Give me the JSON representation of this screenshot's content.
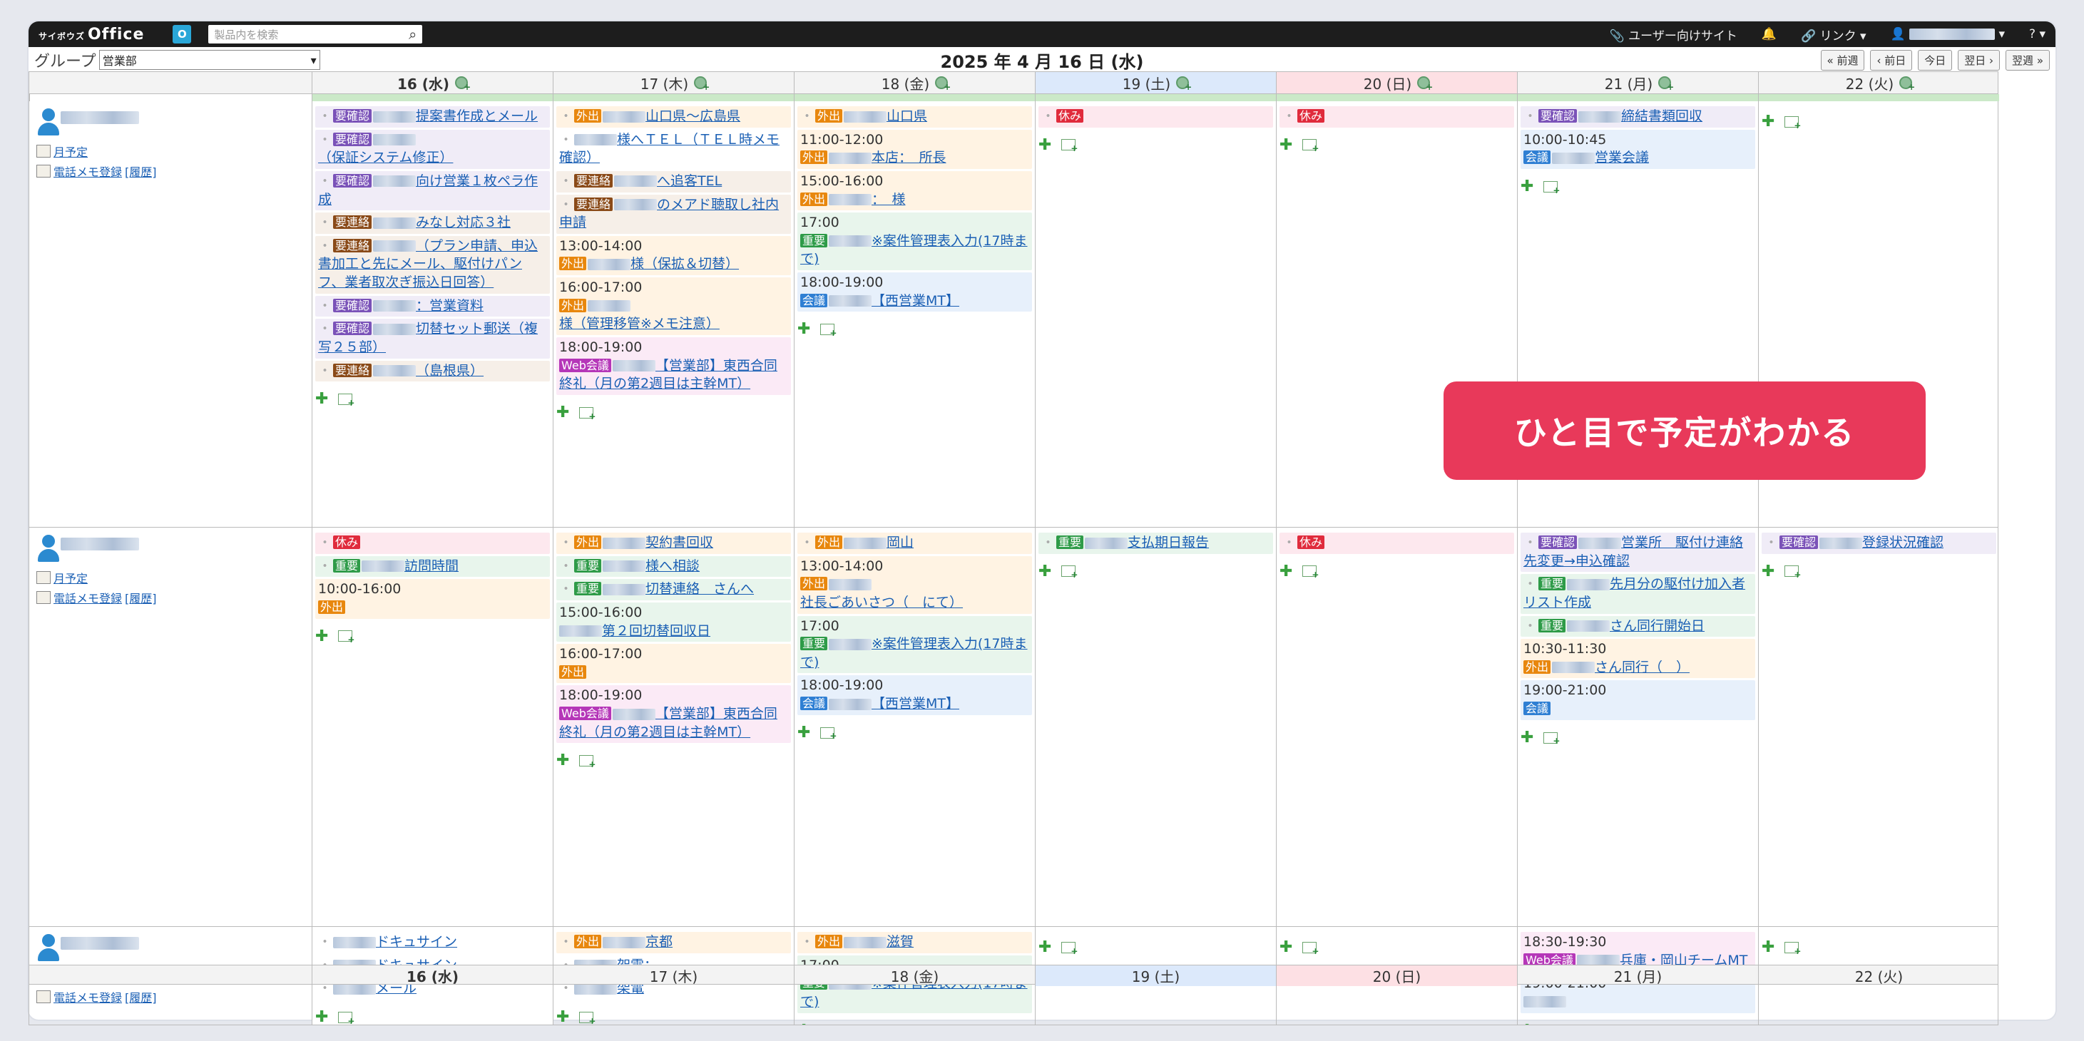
{
  "topbar": {
    "logo_small": "サイボウズ",
    "logo": "Office",
    "search_placeholder": "製品内を検索",
    "user_site": "ユーザー向けサイト",
    "links": "リンク",
    "help": "?"
  },
  "toolbar": {
    "group_label": "グループ",
    "group_value": "営業部",
    "date_title": "2025 年 4 月 16 日 (水)",
    "prev_week": "« 前週",
    "prev_day": "‹ 前日",
    "today": "今日",
    "next_day": "翌日 ›",
    "next_week": "翌週 »"
  },
  "days": [
    {
      "label": "16 (水)",
      "type": "today"
    },
    {
      "label": "17 (木)",
      "type": "weekday"
    },
    {
      "label": "18 (金)",
      "type": "weekday"
    },
    {
      "label": "19 (土)",
      "type": "sat"
    },
    {
      "label": "20 (日)",
      "type": "sun"
    },
    {
      "label": "21 (月)",
      "type": "weekday"
    },
    {
      "label": "22 (火)",
      "type": "weekday"
    }
  ],
  "user_links": {
    "monthly": "月予定",
    "phone_memo": "電話メモ登録",
    "history": "[履歴]"
  },
  "tags": {
    "kakunin": "要確認",
    "renraku": "要連絡",
    "gaishutsu": "外出",
    "juyo": "重要",
    "kaigi": "会議",
    "web": "Web会議",
    "yasumi": "休み"
  },
  "users": [
    {
      "days": [
        [
          {
            "c": "purple",
            "tag": "kakunin",
            "text": "提案書作成とメール"
          },
          {
            "c": "purple",
            "tag": "kakunin",
            "text": "（保証システム修正）"
          },
          {
            "c": "purple",
            "tag": "kakunin",
            "text": "向け営業１枚ペラ作成"
          },
          {
            "c": "beige",
            "tag": "renraku",
            "text": "みなし対応３社"
          },
          {
            "c": "beige",
            "tag": "renraku",
            "text": "（プラン申請、申込書加工と先にメール、駆付けパンフ、業者取次ぎ振込日回答）"
          },
          {
            "c": "purple",
            "tag": "kakunin",
            "text": "：営業資料"
          },
          {
            "c": "purple",
            "tag": "kakunin",
            "text": "切替セット郵送（複写２５部）"
          },
          {
            "c": "beige",
            "tag": "renraku",
            "text": "（島根県）"
          }
        ],
        [
          {
            "c": "orange",
            "tag": "gaishutsu",
            "text": "山口県～広島県"
          },
          {
            "c": "plain",
            "text": "様へＴＥＬ（ＴＥＬ時メモ確認）"
          },
          {
            "c": "beige",
            "tag": "renraku",
            "text": "へ追客TEL"
          },
          {
            "c": "beige",
            "tag": "renraku",
            "text": "のメアド聴取し社内申請"
          },
          {
            "c": "orange",
            "time": "13:00-14:00",
            "tag": "gaishutsu",
            "text": "様（保拡＆切替）"
          },
          {
            "c": "orange",
            "time": "16:00-17:00",
            "tag": "gaishutsu",
            "text": "様（管理移管※メモ注意）"
          },
          {
            "c": "mag",
            "time": "18:00-19:00",
            "tag": "web",
            "text": "【営業部】東西合同終礼（月の第2週目は主幹MT）"
          }
        ],
        [
          {
            "c": "orange",
            "tag": "gaishutsu",
            "text": "山口県"
          },
          {
            "c": "orange",
            "time": "11:00-12:00",
            "tag": "gaishutsu",
            "text": "本店：　所長"
          },
          {
            "c": "orange",
            "time": "15:00-16:00",
            "tag": "gaishutsu",
            "text": "：　様"
          },
          {
            "c": "green",
            "time": "17:00",
            "tag": "juyo",
            "text": "※案件管理表入力(17時まで)"
          },
          {
            "c": "blue",
            "time": "18:00-19:00",
            "tag": "kaigi",
            "text": "【西営業MT】"
          }
        ],
        [
          {
            "c": "pink",
            "tag": "yasumi",
            "text": ""
          }
        ],
        [
          {
            "c": "pink",
            "tag": "yasumi",
            "text": ""
          }
        ],
        [
          {
            "c": "purple",
            "tag": "kakunin",
            "text": "締結書類回収"
          },
          {
            "c": "blue",
            "time": "10:00-10:45",
            "tag": "kaigi",
            "text": "営業会議"
          }
        ],
        []
      ]
    },
    {
      "days": [
        [
          {
            "c": "pink",
            "tag": "yasumi",
            "text": ""
          },
          {
            "c": "green",
            "tag": "juyo",
            "text": "訪問時間"
          },
          {
            "c": "orange",
            "time": "10:00-16:00",
            "tag": "gaishutsu",
            "text": ""
          }
        ],
        [
          {
            "c": "orange",
            "tag": "gaishutsu",
            "text": "契約書回収"
          },
          {
            "c": "green",
            "tag": "juyo",
            "text": "様へ相談"
          },
          {
            "c": "green",
            "tag": "juyo",
            "text": "切替連絡　さんへ"
          },
          {
            "c": "green",
            "time": "15:00-16:00",
            "text": "第２回切替回収日"
          },
          {
            "c": "orange",
            "time": "16:00-17:00",
            "tag": "gaishutsu",
            "text": ""
          },
          {
            "c": "mag",
            "time": "18:00-19:00",
            "tag": "web",
            "text": "【営業部】東西合同終礼（月の第2週目は主幹MT）"
          }
        ],
        [
          {
            "c": "orange",
            "tag": "gaishutsu",
            "text": "岡山"
          },
          {
            "c": "orange",
            "time": "13:00-14:00",
            "tag": "gaishutsu",
            "text": "社長ごあいさつ（　にて）"
          },
          {
            "c": "green",
            "time": "17:00",
            "tag": "juyo",
            "text": "※案件管理表入力(17時まで)"
          },
          {
            "c": "blue",
            "time": "18:00-19:00",
            "tag": "kaigi",
            "text": "【西営業MT】"
          }
        ],
        [
          {
            "c": "green",
            "tag": "juyo",
            "text": "支払期日報告"
          }
        ],
        [
          {
            "c": "pink",
            "tag": "yasumi",
            "text": ""
          }
        ],
        [
          {
            "c": "purple",
            "tag": "kakunin",
            "text": "営業所　駆付け連絡先変更→申込確認"
          },
          {
            "c": "green",
            "tag": "juyo",
            "text": "先月分の駆付け加入者リスト作成"
          },
          {
            "c": "green",
            "tag": "juyo",
            "text": "さん同行開始日"
          },
          {
            "c": "orange",
            "time": "10:30-11:30",
            "tag": "gaishutsu",
            "text": "さん同行（　）"
          },
          {
            "c": "blue",
            "time": "19:00-21:00",
            "tag": "kaigi",
            "text": ""
          }
        ],
        [
          {
            "c": "purple",
            "tag": "kakunin",
            "text": "登録状況確認"
          }
        ]
      ]
    },
    {
      "days": [
        [
          {
            "c": "plain",
            "text": "ドキュサイン"
          },
          {
            "c": "plain",
            "text": "ドキュサイン"
          },
          {
            "c": "plain",
            "text": "メール"
          }
        ],
        [
          {
            "c": "orange",
            "tag": "gaishutsu",
            "text": "京都"
          },
          {
            "c": "plain",
            "text": "架電："
          },
          {
            "c": "plain",
            "text": "架電"
          }
        ],
        [
          {
            "c": "orange",
            "tag": "gaishutsu",
            "text": "滋賀"
          },
          {
            "c": "green",
            "time": "17:00",
            "tag": "juyo",
            "text": "※案件管理表入力(17時まで)"
          }
        ],
        [],
        [],
        [
          {
            "c": "mag",
            "time": "18:30-19:30",
            "warn": true,
            "tag": "web",
            "text": "兵庫・岡山チームMT"
          },
          {
            "c": "blue",
            "time": "19:00-21:00",
            "warn": true,
            "text": ""
          }
        ],
        []
      ]
    }
  ],
  "callout": "ひと目で予定がわかる"
}
